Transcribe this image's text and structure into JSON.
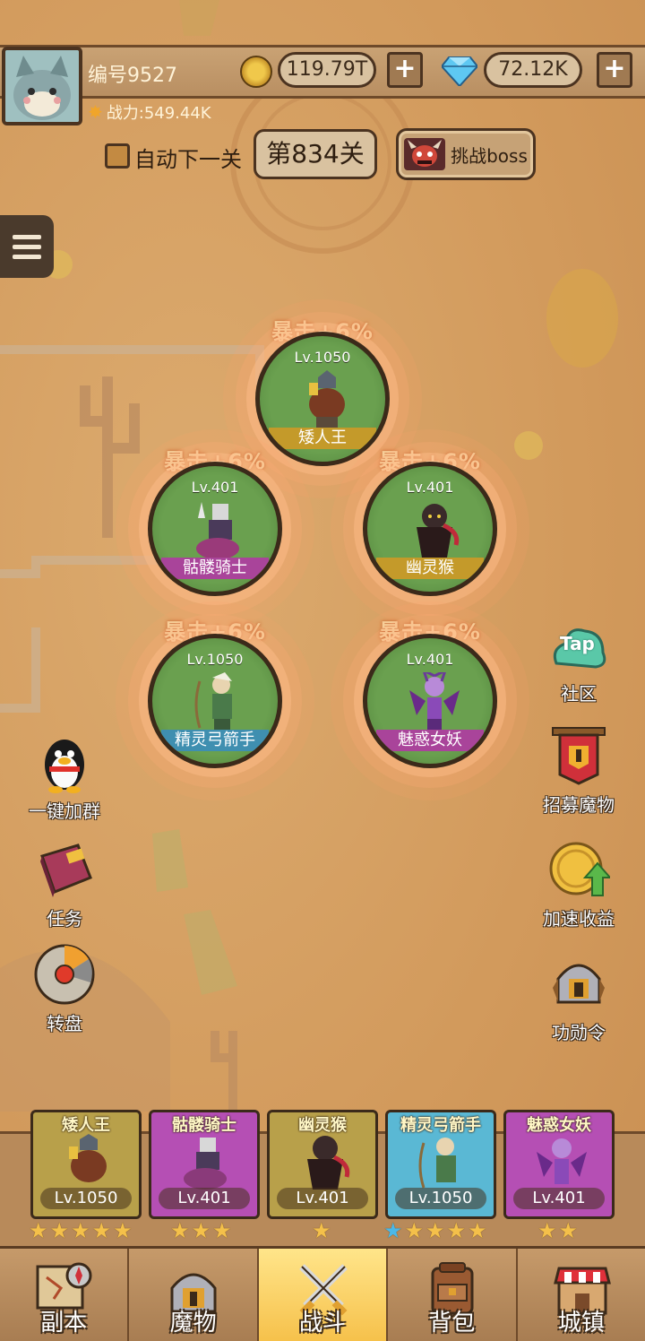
{
  "player": {
    "id_label": "编号9527",
    "power_label": "战力:549.44K"
  },
  "currency": {
    "gold": "119.79T",
    "gems": "72.12K",
    "plus": "+"
  },
  "stage": {
    "auto_next_label": "自动下一关",
    "stage_label": "第834关",
    "boss_button": "挑战boss"
  },
  "heroes": [
    {
      "name": "矮人王",
      "level": "Lv.1050",
      "buff": "暴击+6%"
    },
    {
      "name": "骷髅骑士",
      "level": "Lv.401",
      "buff": "暴击+6%"
    },
    {
      "name": "幽灵猴",
      "level": "Lv.401",
      "buff": "暴击+6%"
    },
    {
      "name": "精灵弓箭手",
      "level": "Lv.1050",
      "buff": "暴击+6%"
    },
    {
      "name": "魅惑女妖",
      "level": "Lv.401",
      "buff": "暴击+6%"
    }
  ],
  "side_left": [
    {
      "label": "一键加群",
      "icon": "qq-penguin-icon"
    },
    {
      "label": "任务",
      "icon": "quest-book-icon"
    },
    {
      "label": "转盘",
      "icon": "wheel-icon"
    }
  ],
  "side_right": [
    {
      "label": "社区",
      "icon": "tap-community-icon",
      "badge": "Tap"
    },
    {
      "label": "招募魔物",
      "icon": "recruit-banner-icon"
    },
    {
      "label": "加速收益",
      "icon": "speed-coin-icon"
    },
    {
      "label": "功勋令",
      "icon": "helmet-icon"
    }
  ],
  "team": [
    {
      "name": "矮人王",
      "level": "Lv.1050",
      "stars": 5,
      "blue_stars": 0,
      "color": "#b8a04a"
    },
    {
      "name": "骷髅骑士",
      "level": "Lv.401",
      "stars": 3,
      "blue_stars": 0,
      "color": "#b54fb4"
    },
    {
      "name": "幽灵猴",
      "level": "Lv.401",
      "stars": 1,
      "blue_stars": 0,
      "color": "#b8a04a"
    },
    {
      "name": "精灵弓箭手",
      "level": "Lv.1050",
      "stars": 5,
      "blue_stars": 1,
      "color": "#5ab8d4"
    },
    {
      "name": "魅惑女妖",
      "level": "Lv.401",
      "stars": 2,
      "blue_stars": 0,
      "color": "#b54fb4"
    }
  ],
  "nav": [
    {
      "label": "副本",
      "icon": "map-compass-icon"
    },
    {
      "label": "魔物",
      "icon": "monster-helmet-icon"
    },
    {
      "label": "战斗",
      "icon": "crossed-swords-icon",
      "active": true
    },
    {
      "label": "背包",
      "icon": "backpack-icon"
    },
    {
      "label": "城镇",
      "icon": "town-shop-icon"
    }
  ],
  "colors": {
    "ground": "#d7a266",
    "hero_green": "#6aa04f",
    "star_gold": "#f4c04a",
    "star_blue": "#4bb8e8",
    "nav_active": "#f6c14b"
  }
}
